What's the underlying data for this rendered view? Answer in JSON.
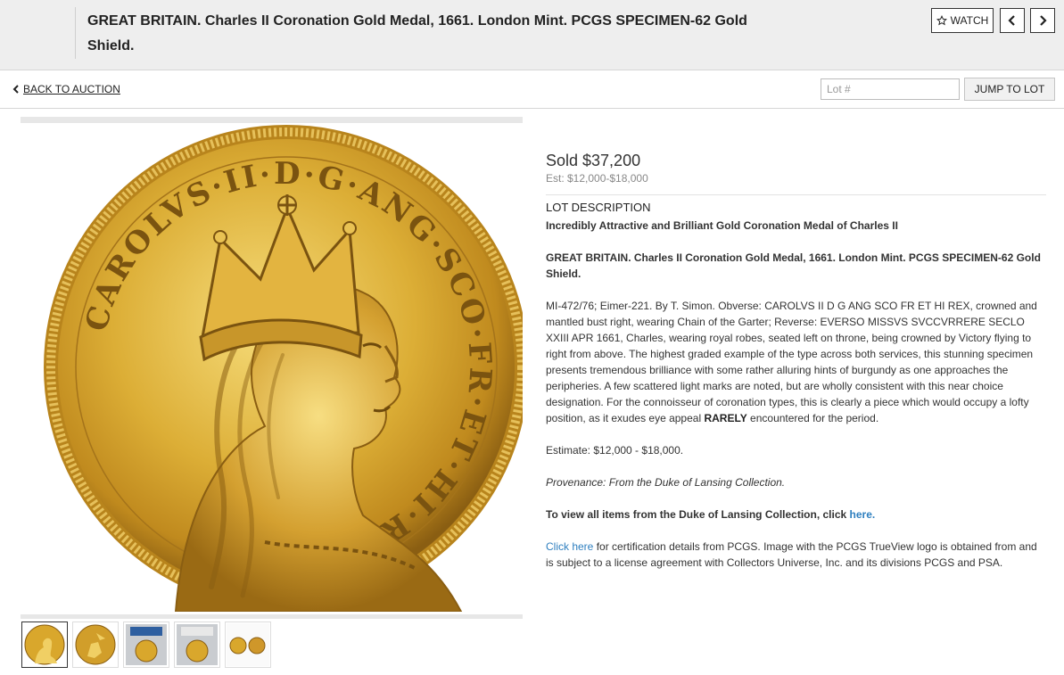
{
  "header": {
    "title": "GREAT BRITAIN. Charles II Coronation Gold Medal, 1661. London Mint. PCGS SPECIMEN-62 Gold Shield.",
    "watch_label": "WATCH"
  },
  "nav": {
    "back_label": "BACK TO AUCTION",
    "lot_placeholder": "Lot #",
    "jump_label": "JUMP TO LOT"
  },
  "lot": {
    "sold": "Sold $37,200",
    "estimate_range": "Est: $12,000-$18,000",
    "section_heading": "LOT DESCRIPTION",
    "headline": "Incredibly Attractive and Brilliant Gold Coronation Medal of Charles II",
    "title": "GREAT BRITAIN. Charles II Coronation Gold Medal, 1661. London Mint. PCGS SPECIMEN-62 Gold Shield.",
    "description_main": "MI-472/76; Eimer-221. By T. Simon. Obverse: CAROLVS II D G ANG SCO FR ET HI REX, crowned and mantled bust right, wearing Chain of the Garter; Reverse: EVERSO MISSVS SVCCVRRERE SECLO XXIII APR 1661, Charles, wearing royal robes, seated left on throne, being crowned by Victory flying to right from above. The highest graded example of the type across both services, this stunning specimen presents tremendous brilliance with some rather alluring hints of burgundy as one approaches the peripheries. A few scattered light marks are noted, but are wholly consistent with this near choice designation. For the connoisseur of coronation types, this is clearly a piece which would occupy a lofty position, as it exudes eye appeal",
    "description_emph": "RARELY",
    "description_tail": "encountered for the period.",
    "estimate_line": "Estimate: $12,000 - $18,000.",
    "provenance": "Provenance: From the Duke of Lansing Collection.",
    "view_all_text": "To view all items from the Duke of Lansing Collection, click",
    "view_all_link": "here.",
    "cert_link": "Click here",
    "cert_text": "for certification details from PCGS. Image with the PCGS TrueView logo is obtained from and is subject to a license agreement with Collectors Universe, Inc. and its divisions PCGS and PSA."
  },
  "coin_legend": "CAROLVS·II·D·G·ANG·SCO·FR·ET·HI·REX",
  "thumbnails": [
    "obverse",
    "reverse",
    "slab-front",
    "slab-back",
    "trueview"
  ],
  "colors": {
    "gold_light": "#f3d46a",
    "gold_mid": "#d9a72c",
    "gold_dark": "#8a5e12",
    "link": "#2e7fbf"
  }
}
